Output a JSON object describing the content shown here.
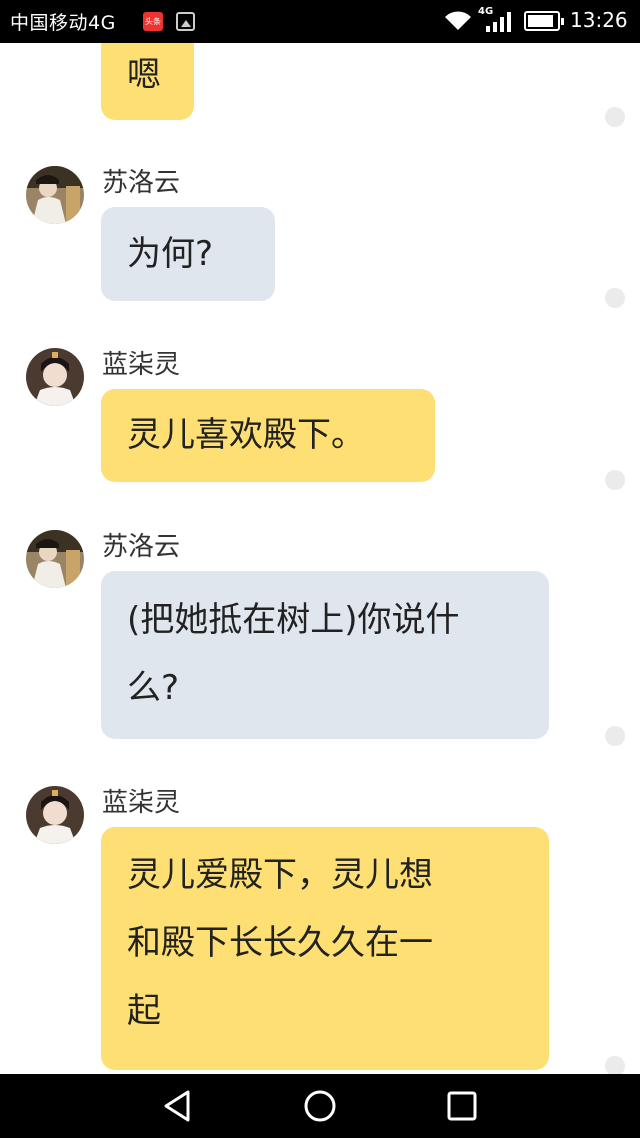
{
  "status_bar": {
    "carrier": "中国移动4G",
    "app_badge": "头条",
    "network_type": "4G",
    "time": "13:26",
    "battery_level": 0.9
  },
  "messages": [
    {
      "sender": "",
      "text": "嗯",
      "style": "yellow"
    },
    {
      "sender": "苏洛云",
      "text": "为何?",
      "style": "gray",
      "avatar": "avatar-su-luoyun"
    },
    {
      "sender": "蓝柒灵",
      "text": "灵儿喜欢殿下。",
      "style": "yellow",
      "avatar": "avatar-lan-qiling"
    },
    {
      "sender": "苏洛云",
      "text_lines": [
        "(把她抵在树上)你说什",
        "么?"
      ],
      "style": "gray",
      "avatar": "avatar-su-luoyun"
    },
    {
      "sender": "蓝柒灵",
      "text_lines": [
        "灵儿爱殿下，灵儿想",
        "和殿下长长久久在一",
        "起"
      ],
      "style": "yellow",
      "avatar": "avatar-lan-qiling"
    }
  ],
  "nav_bar": {
    "back": "back-triangle-icon",
    "home": "home-circle-icon",
    "recents": "recents-square-icon"
  },
  "colors": {
    "yellow_bubble": "#fedf73",
    "gray_bubble": "#dfe6ee",
    "status_bar_bg": "#000000",
    "nav_bar_bg": "#000000"
  }
}
